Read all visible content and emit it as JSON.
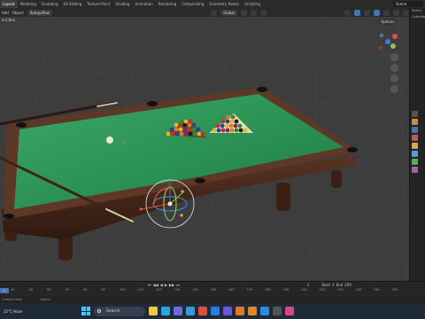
{
  "workspace_tabs": [
    "Layout",
    "Modeling",
    "Sculpting",
    "UV Editing",
    "Texture Paint",
    "Shading",
    "Animation",
    "Rendering",
    "Compositing",
    "Geometry Nodes",
    "Scripting"
  ],
  "active_tab": "Layout",
  "scene_field": "Scene",
  "viewport_header": {
    "menus": [
      "Add",
      "Object"
    ],
    "mode_dropdown": "Retopoflow",
    "transform_dropdown": "Global",
    "tool_label": "ect Box"
  },
  "options_label": "Options",
  "outliner_rows": [
    "Scene",
    "Collection"
  ],
  "timeline": {
    "ruler_ticks": [
      "40",
      "50",
      "60",
      "70",
      "80",
      "90",
      "100",
      "110",
      "120",
      "130",
      "140",
      "150",
      "160",
      "170",
      "180",
      "190",
      "200",
      "210",
      "220",
      "230",
      "240",
      "250"
    ],
    "current_frame": "1",
    "start_label": "Start",
    "start_value": "1",
    "end_label": "End",
    "end_value": "250",
    "controls": [
      "⏮",
      "◀◀",
      "◀",
      "▶",
      "▶▶",
      "⏭"
    ]
  },
  "statusbar": {
    "left": "Camera View",
    "right": "Object"
  },
  "taskbar": {
    "weather": "22°C Haze",
    "search_placeholder": "Search",
    "apps": [
      "file-explorer",
      "edge",
      "store",
      "photos",
      "chrome",
      "vscode",
      "teams",
      "blender",
      "illustrator",
      "photoshop",
      "obs",
      "media"
    ],
    "time": "",
    "date": ""
  },
  "colors": {
    "felt": "#2f9e5a",
    "felt_dark": "#1f7a40",
    "wood": "#4a2a1c",
    "accent": "#4772b3"
  }
}
